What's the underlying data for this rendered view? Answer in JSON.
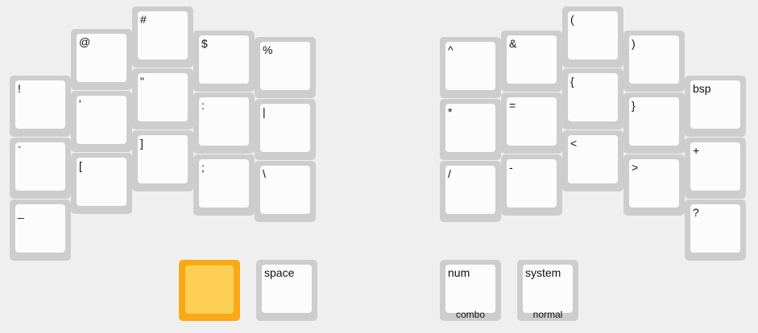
{
  "layer_keys": {
    "left": [
      {
        "id": "l-c0-r0",
        "tap": "!"
      },
      {
        "id": "l-c0-r1",
        "tap": "`"
      },
      {
        "id": "l-c0-r2",
        "tap": "_"
      },
      {
        "id": "l-c1-r0",
        "tap": "@"
      },
      {
        "id": "l-c1-r1",
        "tap": "'"
      },
      {
        "id": "l-c1-r2",
        "tap": "["
      },
      {
        "id": "l-c2-r0",
        "tap": "#"
      },
      {
        "id": "l-c2-r1",
        "tap": "\""
      },
      {
        "id": "l-c2-r2",
        "tap": "]"
      },
      {
        "id": "l-c3-r0",
        "tap": "$"
      },
      {
        "id": "l-c3-r1",
        "tap": ":"
      },
      {
        "id": "l-c3-r2",
        "tap": ";"
      },
      {
        "id": "l-c4-r0",
        "tap": "%"
      },
      {
        "id": "l-c4-r1",
        "tap": "|"
      },
      {
        "id": "l-c4-r2",
        "tap": "\\"
      }
    ],
    "right": [
      {
        "id": "r-c0-r0",
        "tap": "^"
      },
      {
        "id": "r-c0-r1",
        "tap": "*"
      },
      {
        "id": "r-c0-r2",
        "tap": "/"
      },
      {
        "id": "r-c1-r0",
        "tap": "&"
      },
      {
        "id": "r-c1-r1",
        "tap": "="
      },
      {
        "id": "r-c1-r2",
        "tap": "-"
      },
      {
        "id": "r-c2-r0",
        "tap": "("
      },
      {
        "id": "r-c2-r1",
        "tap": "{"
      },
      {
        "id": "r-c2-r2",
        "tap": "<"
      },
      {
        "id": "r-c3-r0",
        "tap": ")"
      },
      {
        "id": "r-c3-r1",
        "tap": "}"
      },
      {
        "id": "r-c3-r2",
        "tap": ">"
      },
      {
        "id": "r-c4-r0",
        "tap": "bsp"
      },
      {
        "id": "r-c4-r1",
        "tap": "+"
      },
      {
        "id": "r-c4-r2",
        "tap": "?"
      }
    ],
    "thumbs": [
      {
        "id": "t-left-inner",
        "tap": "",
        "held": true
      },
      {
        "id": "t-left-outer",
        "tap": "space"
      },
      {
        "id": "t-right-inner",
        "tap": "num",
        "hold": "combo"
      },
      {
        "id": "t-right-outer",
        "tap": "system",
        "hold": "normal"
      }
    ]
  },
  "colors": {
    "key_border": "#cdcdcd",
    "key_face": "#fcfcfc",
    "held_border": "#f9a817",
    "held_face": "#fdd055",
    "background": "#efefef"
  }
}
